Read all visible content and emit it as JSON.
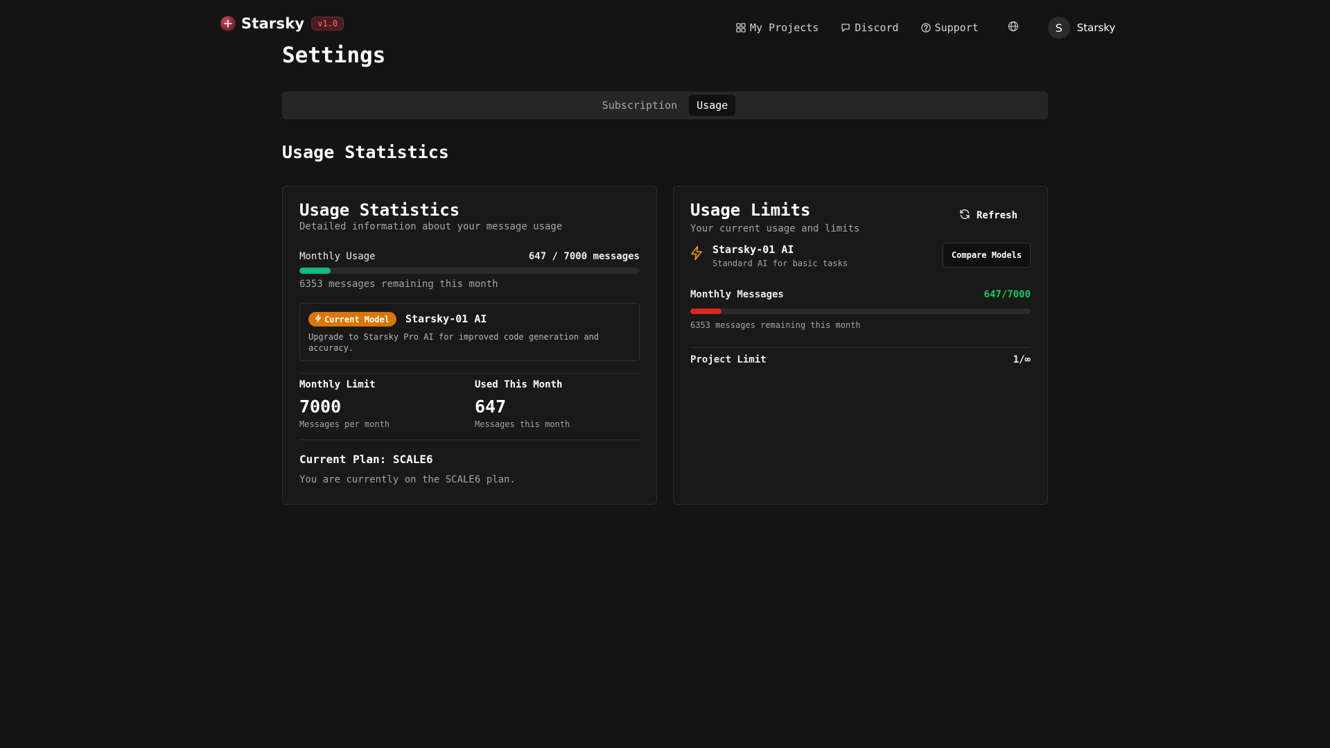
{
  "header": {
    "brand": "Starsky",
    "version": "v1.0",
    "nav": [
      {
        "label": "My Projects",
        "icon": "grid-icon"
      },
      {
        "label": "Discord",
        "icon": "chat-icon"
      },
      {
        "label": "Support",
        "icon": "help-circle-icon"
      }
    ],
    "globe_icon": "globe-icon",
    "user": {
      "initial": "S",
      "name": "Starsky"
    }
  },
  "page": {
    "title": "Settings",
    "tabs": [
      {
        "label": "Subscription",
        "active": false
      },
      {
        "label": "Usage",
        "active": true
      }
    ],
    "section_title": "Usage Statistics"
  },
  "usage_card": {
    "title": "Usage Statistics",
    "subtitle": "Detailed information about your message usage",
    "monthly_usage_label": "Monthly Usage",
    "monthly_usage_value": "647 / 7000 messages",
    "progress_fraction": 0.0924,
    "progress_color": "#10b981",
    "remaining_text": "6353 messages remaining this month",
    "model_badge": "Current Model",
    "model_name": "Starsky-01 AI",
    "model_desc": "Upgrade to Starsky Pro AI for improved code generation and accuracy.",
    "monthly_limit_label": "Monthly Limit",
    "monthly_limit_value": "7000",
    "monthly_limit_sub": "Messages per month",
    "used_label": "Used This Month",
    "used_value": "647",
    "used_sub": "Messages this month",
    "plan_title": "Current Plan: SCALE6",
    "plan_desc": "You are currently on the SCALE6 plan."
  },
  "limits_card": {
    "title": "Usage Limits",
    "subtitle": "Your current usage and limits",
    "refresh_label": "Refresh",
    "model_name": "Starsky-01 AI",
    "model_desc": "Standard AI for basic tasks",
    "compare_label": "Compare Models",
    "messages_label": "Monthly Messages",
    "messages_value": "647/7000",
    "progress_fraction": 0.0924,
    "progress_color": "#dc2626",
    "remaining_text": "6353 messages remaining this month",
    "project_label": "Project Limit",
    "project_value": "1/∞"
  }
}
